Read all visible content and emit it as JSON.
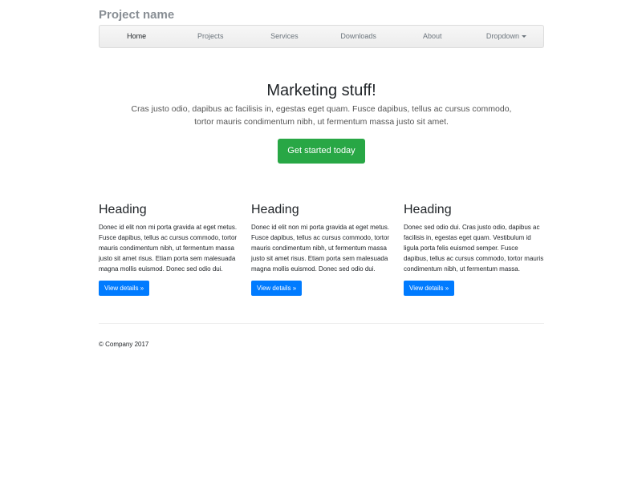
{
  "header": {
    "brand": "Project name"
  },
  "nav": {
    "items": [
      {
        "label": "Home"
      },
      {
        "label": "Projects"
      },
      {
        "label": "Services"
      },
      {
        "label": "Downloads"
      },
      {
        "label": "About"
      },
      {
        "label": "Dropdown"
      }
    ],
    "active_index": 0
  },
  "hero": {
    "title": "Marketing stuff!",
    "lead": "Cras justo odio, dapibus ac facilisis in, egestas eget quam. Fusce dapibus, tellus ac cursus commodo, tortor mauris condimentum nibh, ut fermentum massa justo sit amet.",
    "cta_label": "Get started today"
  },
  "features": [
    {
      "heading": "Heading",
      "body": "Donec id elit non mi porta gravida at eget metus. Fusce dapibus, tellus ac cursus commodo, tortor mauris condimentum nibh, ut fermentum massa justo sit amet risus. Etiam porta sem malesuada magna mollis euismod. Donec sed odio dui.",
      "button_label": "View details »"
    },
    {
      "heading": "Heading",
      "body": "Donec id elit non mi porta gravida at eget metus. Fusce dapibus, tellus ac cursus commodo, tortor mauris condimentum nibh, ut fermentum massa justo sit amet risus. Etiam porta sem malesuada magna mollis euismod. Donec sed odio dui.",
      "button_label": "View details »"
    },
    {
      "heading": "Heading",
      "body": "Donec sed odio dui. Cras justo odio, dapibus ac facilisis in, egestas eget quam. Vestibulum id ligula porta felis euismod semper. Fusce dapibus, tellus ac cursus commodo, tortor mauris condimentum nibh, ut fermentum massa.",
      "button_label": "View details »"
    }
  ],
  "footer": {
    "text": "© Company 2017"
  },
  "colors": {
    "success": "#28a745",
    "primary": "#007bff",
    "muted": "#6c757d"
  }
}
